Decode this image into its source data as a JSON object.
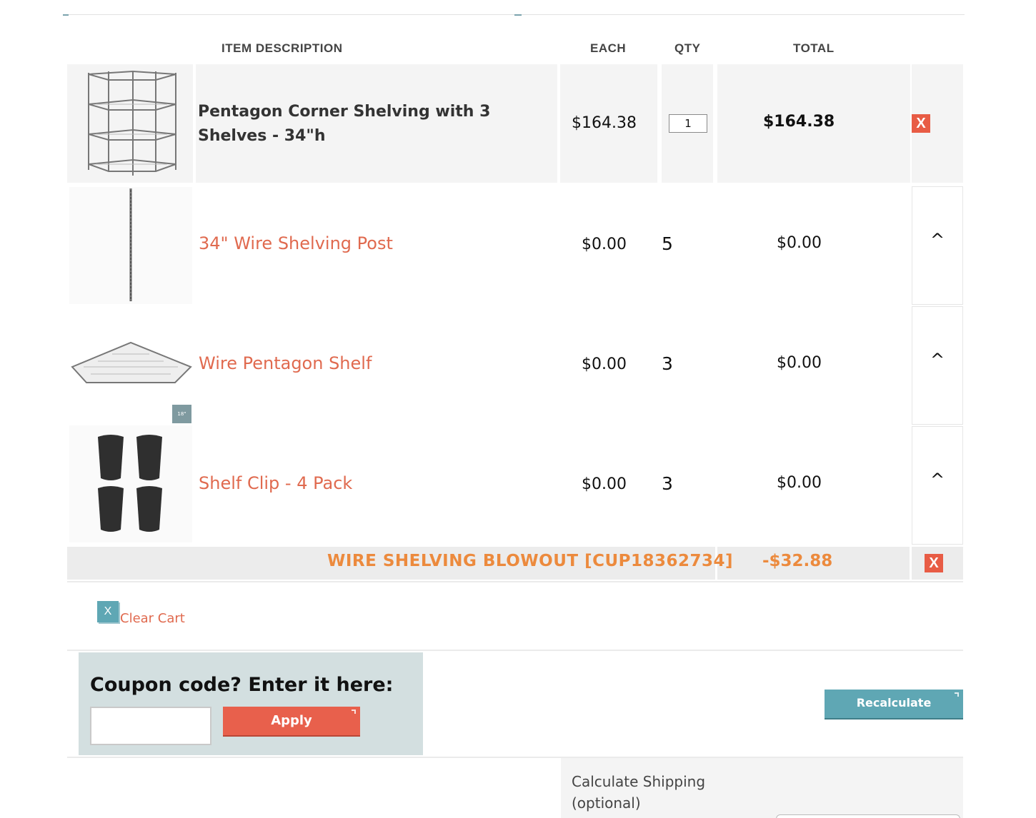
{
  "table_headers": {
    "description": "ITEM  DESCRIPTION",
    "each": "EACH",
    "qty": "QTY",
    "total": "TOTAL"
  },
  "main_item": {
    "title": "Pentagon Corner Shelving with 3 Shelves - 34\"h",
    "each": "$164.38",
    "qty": "1",
    "total": "$164.38",
    "remove_label": "X",
    "image_icon": "wire-shelving-unit-image"
  },
  "components": [
    {
      "title": "34\" Wire Shelving Post",
      "each": "$0.00",
      "qty": "5",
      "total": "$0.00",
      "toggle": "^",
      "image_icon": "shelving-post-image"
    },
    {
      "title": "Wire Pentagon Shelf",
      "each": "$0.00",
      "qty": "3",
      "total": "$0.00",
      "toggle": "^",
      "image_icon": "pentagon-shelf-image"
    },
    {
      "title": "Shelf Clip - 4 Pack",
      "each": "$0.00",
      "qty": "3",
      "total": "$0.00",
      "toggle": "^",
      "image_icon": "shelf-clip-image",
      "badge": "18\""
    }
  ],
  "coupon_line": {
    "name": "WIRE SHELVING BLOWOUT [CUP18362734]",
    "amount": "-$32.88",
    "remove_label": "X"
  },
  "clear_cart": {
    "icon_label": "X",
    "label": "Clear Cart"
  },
  "coupon_form": {
    "heading": "Coupon code? Enter it here:",
    "input_value": "",
    "apply_label": "Apply"
  },
  "recalculate_label": "Recalculate",
  "shipping": {
    "label": "Calculate Shipping (optional)"
  },
  "colors": {
    "accent_red": "#e8604c",
    "link_orange": "#e06a4f",
    "coupon_orange": "#ec8a3d",
    "teal": "#5fa7b4",
    "panel_blue_grey": "#d3dfe0"
  }
}
